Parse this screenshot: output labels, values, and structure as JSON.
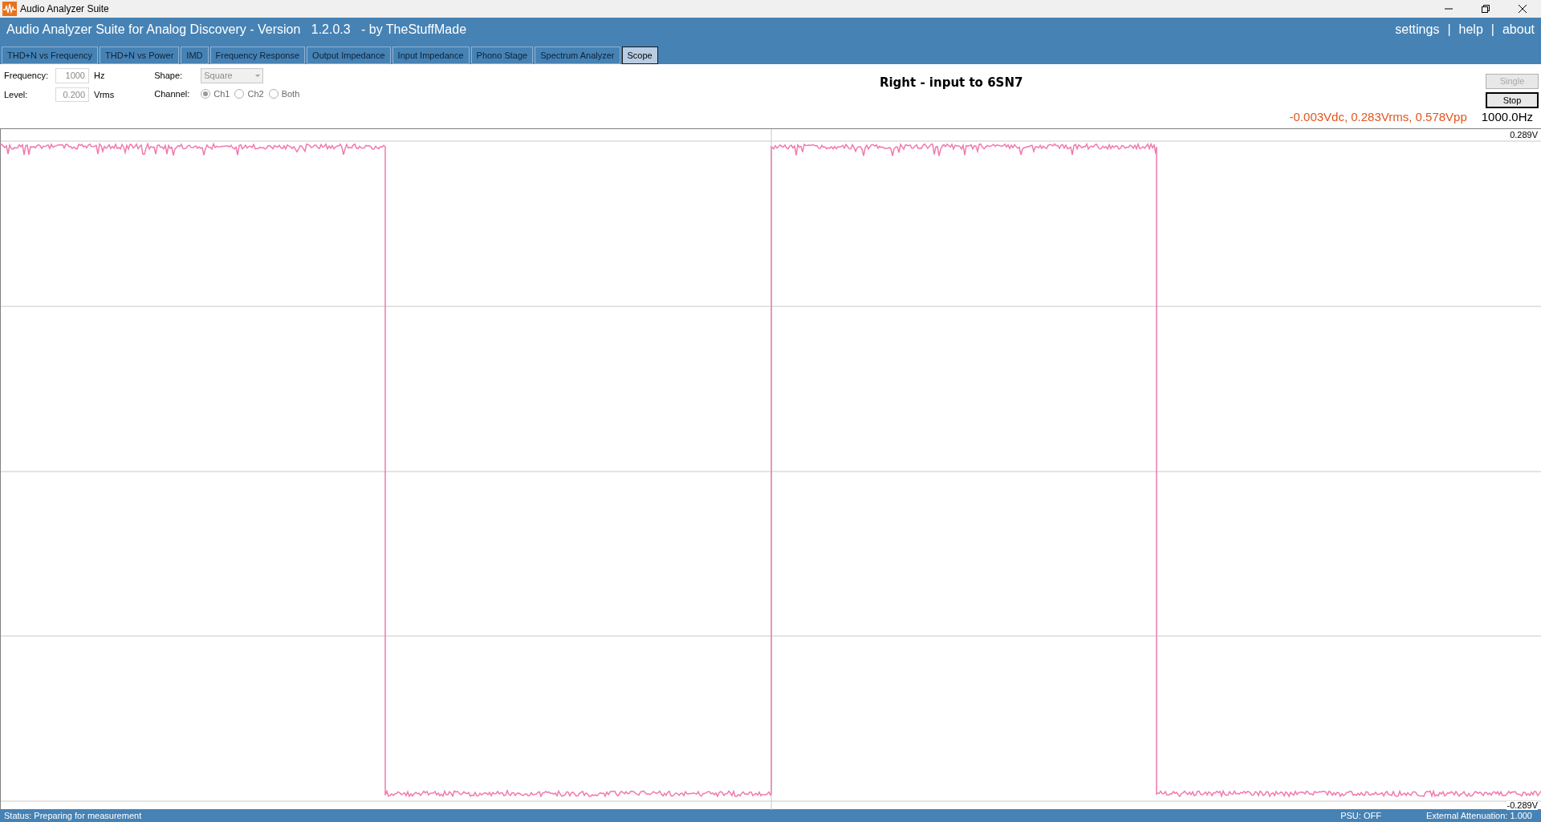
{
  "window": {
    "title": "Audio Analyzer Suite"
  },
  "header": {
    "title": "Audio Analyzer Suite for Analog Discovery - Version   1.2.0.3   - by TheStuffMade",
    "links": [
      "settings",
      "help",
      "about"
    ],
    "separator": "|"
  },
  "tabs": [
    {
      "label": "THD+N vs Frequency",
      "selected": false
    },
    {
      "label": "THD+N vs Power",
      "selected": false
    },
    {
      "label": "IMD",
      "selected": false
    },
    {
      "label": "Frequency Response",
      "selected": false
    },
    {
      "label": "Output Impedance",
      "selected": false
    },
    {
      "label": "Input Impedance",
      "selected": false
    },
    {
      "label": "Phono Stage",
      "selected": false
    },
    {
      "label": "Spectrum Analyzer",
      "selected": false
    },
    {
      "label": "Scope",
      "selected": true
    }
  ],
  "controls": {
    "frequency": {
      "label": "Frequency:",
      "value": "1000",
      "unit": "Hz",
      "disabled": true
    },
    "level": {
      "label": "Level:",
      "value": "0.200",
      "unit": "Vrms",
      "disabled": true
    },
    "shape": {
      "label": "Shape:",
      "value": "Square",
      "disabled": true
    },
    "channel": {
      "label": "Channel:",
      "disabled": true,
      "options": [
        {
          "label": "Ch1",
          "selected": true
        },
        {
          "label": "Ch2",
          "selected": false
        },
        {
          "label": "Both",
          "selected": false
        }
      ]
    }
  },
  "plot_title": "Right - input to 6SN7",
  "buttons": [
    {
      "label": "Single",
      "disabled": true
    },
    {
      "label": "Stop",
      "disabled": false
    }
  ],
  "readout": {
    "measurements": "-0.003Vdc, 0.283Vrms, 0.578Vpp",
    "frequency": "1000.0Hz"
  },
  "scope": {
    "top_label": "0.289V",
    "bottom_label": "-0.289V"
  },
  "status_bar": {
    "status": "Status: Preparing for measurement",
    "psu": "PSU: OFF",
    "attenuation": "External Attenuation: 1.000"
  }
}
